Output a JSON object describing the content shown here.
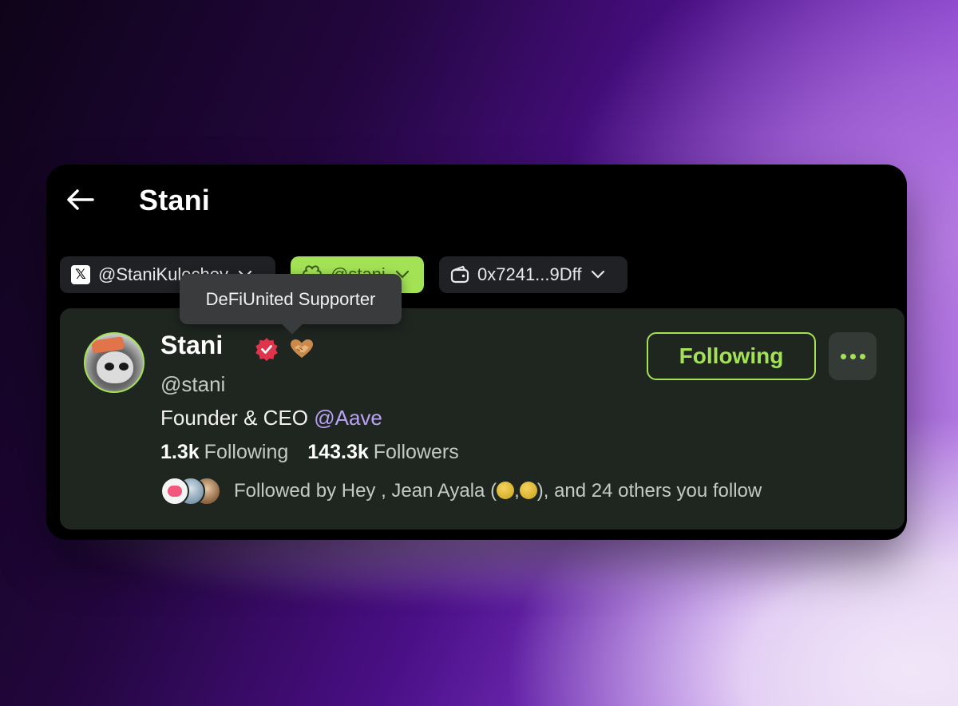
{
  "header": {
    "back_icon": "arrow-left-icon",
    "title": "Stani"
  },
  "chips": {
    "x": {
      "icon": "x-logo-icon",
      "label": "@StaniKulechov"
    },
    "lens": {
      "icon": "lens-icon",
      "label": "@stani"
    },
    "wallet": {
      "icon": "wallet-icon",
      "label": "0x7241...9Dff"
    }
  },
  "tooltip": {
    "text": "DeFiUnited Supporter"
  },
  "profile": {
    "name": "Stani",
    "handle": "@stani",
    "bio_prefix": "Founder & CEO ",
    "bio_mention": "@Aave",
    "following_count": "1.3k",
    "following_label": "Following",
    "followers_count": "143.3k",
    "followers_label": "Followers",
    "followed_by_prefix": "Followed by Hey , Jean Ayala (",
    "followed_by_sep": ",",
    "followed_by_suffix": "), and 24 others you follow"
  },
  "actions": {
    "following_button": "Following",
    "more_icon": "more-horizontal-icon"
  },
  "colors": {
    "accent": "#a4e255",
    "card_bg": "#1f2620",
    "verified": "#e0334c",
    "mention": "#b9a2f5"
  }
}
